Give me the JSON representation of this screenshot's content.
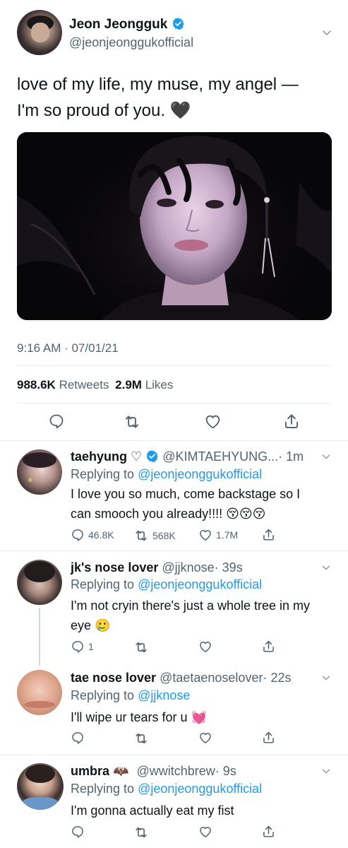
{
  "main_tweet": {
    "display_name": "Jeon Jeongguk",
    "handle": "@jeonjeonggukofficial",
    "text_line1": "love of my life, my muse, my angel —",
    "text_line2": "I'm so proud of you.",
    "emoji": "🖤",
    "timestamp": "9:16 AM · 07/01/21",
    "retweets_count": "988.6K",
    "retweets_label": "Retweets",
    "likes_count": "2.9M",
    "likes_label": "Likes"
  },
  "replies": [
    {
      "display_name": "taehyung",
      "name_suffix": "♡",
      "handle": "@KIMTAEHYUNG...",
      "time": "· 1m",
      "replying_label": "Replying to",
      "replying_to": "@jeonjeonggukofficial",
      "text_line1": "I love you so much, come backstage so I",
      "text_line2": "can smooch you already!!!! 😚😚😚",
      "reply_count": "46.8K",
      "retweet_count": "568K",
      "like_count": "1.7M"
    },
    {
      "display_name": "jk's nose lover",
      "handle": "@jjknose",
      "time": "· 39s",
      "replying_label": "Replying to",
      "replying_to": "@jeonjeonggukofficial",
      "text_line1": "I'm not cryin there's just a whole tree in my",
      "text_line2": "eye 🥲",
      "reply_count": "1"
    },
    {
      "display_name": "tae nose lover",
      "handle": "@taetaenoselover",
      "time": "· 22s",
      "replying_label": "Replying to",
      "replying_to": "@jjknose",
      "text_line1": "I'll wipe ur tears for u 💓"
    },
    {
      "display_name": "umbra",
      "name_suffix": "🦇",
      "handle": "@wwitchbrew",
      "time": "· 9s",
      "replying_label": "Replying to",
      "replying_to": "@jeonjeonggukofficial",
      "text_line1": "I'm gonna actually eat my fist"
    }
  ],
  "icons": {
    "verified": "verified-badge-icon",
    "chevron": "chevron-down-icon",
    "reply": "reply-icon",
    "retweet": "retweet-icon",
    "like": "heart-icon",
    "share": "share-icon"
  },
  "colors": {
    "accent": "#1d9bf0",
    "secondary_text": "#536471",
    "divider": "#e6ecf0",
    "pink_heart": "#e0245e"
  }
}
